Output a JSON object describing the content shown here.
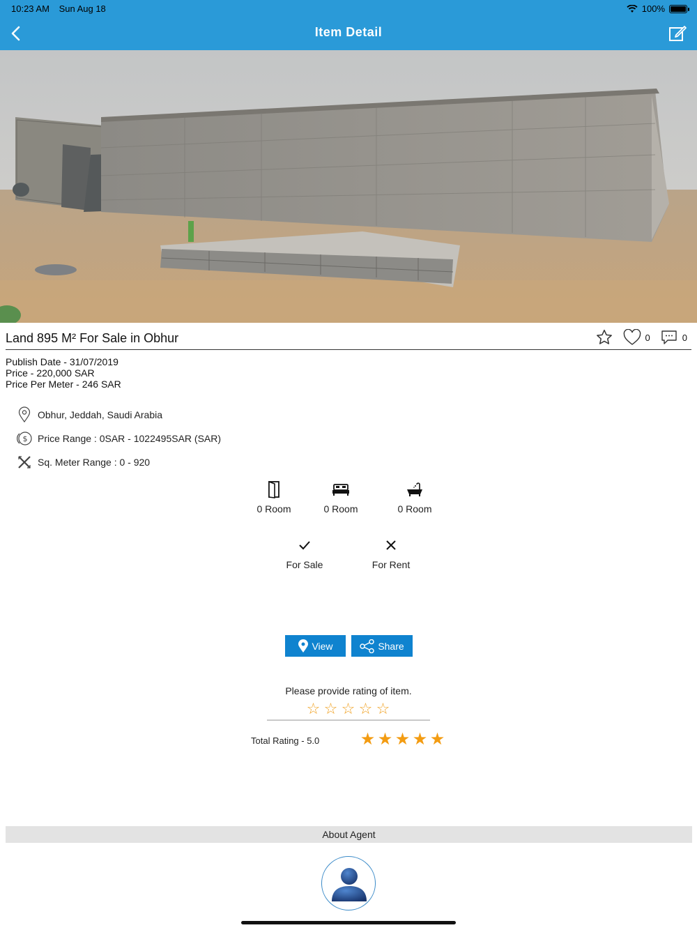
{
  "status_bar": {
    "time": "10:23 AM",
    "date": "Sun Aug 18",
    "battery": "100%"
  },
  "nav": {
    "title": "Item Detail",
    "back_icon": "chevron-left-icon",
    "edit_icon": "edit-icon"
  },
  "hero": {
    "alt": "Concrete block building on sandy land"
  },
  "item": {
    "title": "Land 895 M² For Sale in Obhur",
    "favorites_count": "0",
    "comments_count": "0",
    "publish_date": "Publish Date - 31/07/2019",
    "price": "Price - 220,000 SAR",
    "price_per_meter": "Price Per Meter - 246 SAR"
  },
  "info": {
    "location": "Obhur, Jeddah, Saudi Arabia",
    "price_range": "Price Range : 0SAR - 1022495SAR (SAR)",
    "sq_meter_range": "Sq. Meter Range : 0 - 920"
  },
  "features": {
    "doors": "0 Room",
    "bedrooms": "0 Room",
    "bathrooms": "0 Room"
  },
  "availability": {
    "sale_label": "For Sale",
    "rent_label": "For Rent"
  },
  "buttons": {
    "view_label": "View",
    "share_label": "Share"
  },
  "rating": {
    "prompt": "Please provide rating of item.",
    "user_stars": [
      "☆",
      "☆",
      "☆",
      "☆",
      "☆"
    ],
    "total_label": "Total Rating - 5.0",
    "total_value": 5.0,
    "total_stars": [
      "★",
      "★",
      "★",
      "★",
      "★"
    ]
  },
  "agent": {
    "section_title": "About Agent"
  },
  "colors": {
    "header": "#2a9ad8",
    "button": "#0f83cf",
    "star": "#f39c12"
  }
}
